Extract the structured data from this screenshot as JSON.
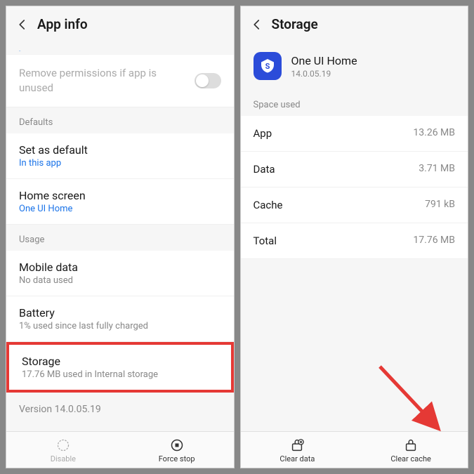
{
  "left": {
    "title": "App info",
    "notifications_fragment": "...........",
    "remove_permissions": "Remove permissions if app is unused",
    "defaults_label": "Defaults",
    "set_default": {
      "title": "Set as default",
      "sub": "In this app"
    },
    "home_screen": {
      "title": "Home screen",
      "sub": "One UI Home"
    },
    "usage_label": "Usage",
    "mobile_data": {
      "title": "Mobile data",
      "sub": "No data used"
    },
    "battery": {
      "title": "Battery",
      "sub": "1% used since last fully charged"
    },
    "storage": {
      "title": "Storage",
      "sub": "17.76 MB used in Internal storage"
    },
    "version": "Version 14.0.05.19",
    "disable_label": "Disable",
    "force_stop_label": "Force stop"
  },
  "right": {
    "title": "Storage",
    "app_name": "One UI Home",
    "app_version": "14.0.05.19",
    "space_used_label": "Space used",
    "rows": [
      {
        "label": "App",
        "value": "13.26 MB"
      },
      {
        "label": "Data",
        "value": "3.71 MB"
      },
      {
        "label": "Cache",
        "value": "791 kB"
      },
      {
        "label": "Total",
        "value": "17.76 MB"
      }
    ],
    "clear_data_label": "Clear data",
    "clear_cache_label": "Clear cache"
  }
}
